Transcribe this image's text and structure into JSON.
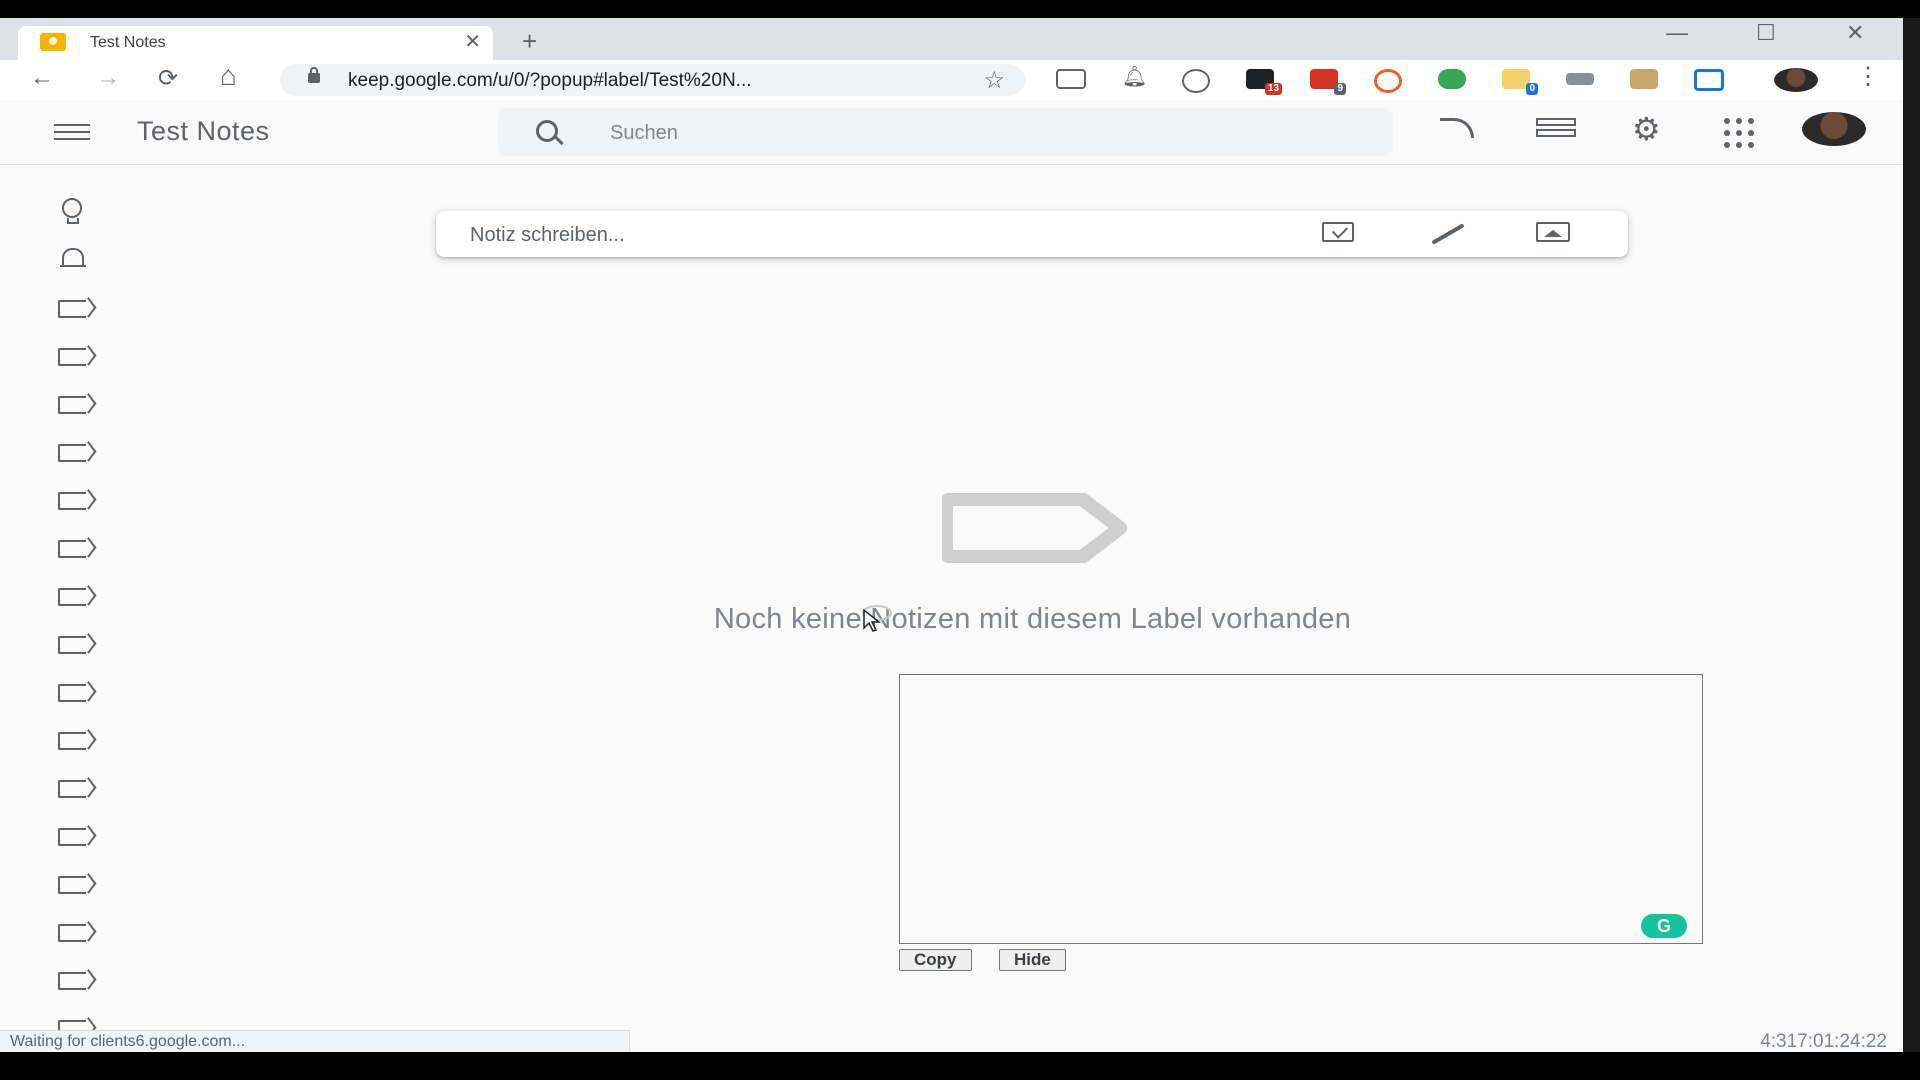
{
  "browser": {
    "tab_title": "Test Notes",
    "tab_close": "✕",
    "new_tab": "+",
    "url": "keep.google.com/u/0/?popup#label/Test%20N...",
    "window_controls": {
      "minimize": "—",
      "maximize": "☐",
      "close": "✕"
    },
    "nav": {
      "back": "←",
      "forward": "→",
      "reload": "⟳",
      "home": "⌂",
      "star": "☆",
      "menu": "⋮"
    },
    "extensions": [
      {
        "name": "screenshot-extension-icon"
      },
      {
        "name": "bell-extension-icon"
      },
      {
        "name": "pocket-extension-icon"
      },
      {
        "name": "calendar-extension-icon",
        "badge": "13",
        "color": "#d93025"
      },
      {
        "name": "mail-extension-icon",
        "badge": "9",
        "color": "#d93025"
      },
      {
        "name": "bitly-extension-icon",
        "color": "#ee6123"
      },
      {
        "name": "idm-extension-icon",
        "color": "#34a853"
      },
      {
        "name": "folder-extension-icon",
        "badge": "0",
        "color": "#1a73e8"
      },
      {
        "name": "chat-extension-icon"
      },
      {
        "name": "box-extension-icon"
      },
      {
        "name": "cast-extension-icon",
        "color": "#1a73e8"
      }
    ]
  },
  "app": {
    "title": "Test Notes",
    "search_placeholder": "Suchen",
    "header_icons": [
      "refresh-icon",
      "list-view-icon",
      "settings-icon",
      "apps-grid-icon",
      "account-avatar"
    ]
  },
  "sidebar": {
    "items": [
      {
        "icon": "bulb"
      },
      {
        "icon": "bell"
      },
      {
        "icon": "label"
      },
      {
        "icon": "label"
      },
      {
        "icon": "label"
      },
      {
        "icon": "label"
      },
      {
        "icon": "label"
      },
      {
        "icon": "label"
      },
      {
        "icon": "label"
      },
      {
        "icon": "label"
      },
      {
        "icon": "label"
      },
      {
        "icon": "label"
      },
      {
        "icon": "label"
      },
      {
        "icon": "label"
      },
      {
        "icon": "label"
      },
      {
        "icon": "label"
      },
      {
        "icon": "label"
      },
      {
        "icon": "label"
      }
    ]
  },
  "main": {
    "note_placeholder": "Notiz schreiben...",
    "empty_message": "Noch keine Notizen mit diesem Label vorhanden",
    "copy_button": "Copy",
    "hide_button": "Hide",
    "grammarly": "G"
  },
  "status": {
    "loading_text": "Waiting for clients6.google.com...",
    "timestamp": "4:317:01:24:22"
  },
  "colors": {
    "accent_keep": "#f4b400",
    "grammarly": "#15c39a",
    "icon_gray": "#5f6368",
    "empty_icon_gray": "#cfcfcf"
  }
}
